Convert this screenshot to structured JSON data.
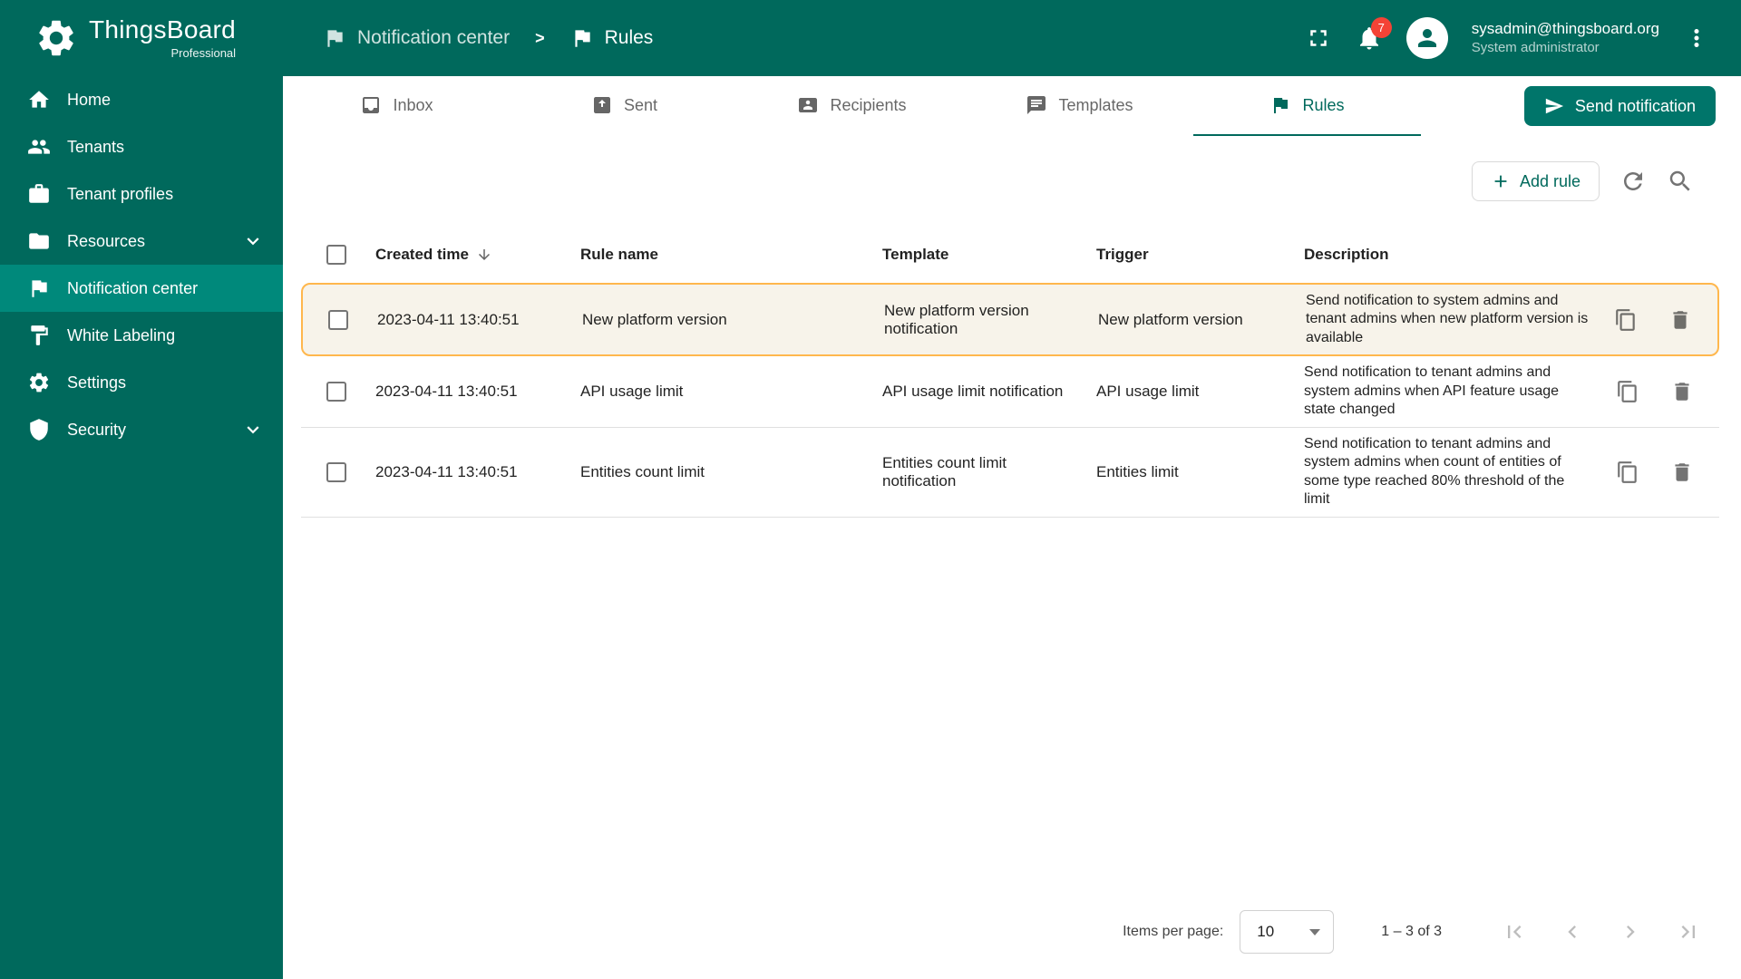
{
  "brand": {
    "name": "ThingsBoard",
    "subtitle": "Professional"
  },
  "header": {
    "breadcrumb": [
      {
        "label": "Notification center",
        "icon": "notification-center-icon"
      },
      {
        "label": "Rules",
        "icon": "rules-icon"
      }
    ],
    "notifications_badge": "7",
    "user": {
      "email": "sysadmin@thingsboard.org",
      "role": "System administrator"
    },
    "icons": [
      "fullscreen-icon",
      "bell-icon",
      "avatar-icon",
      "more-vert-icon"
    ]
  },
  "sidebar": {
    "items": [
      {
        "label": "Home",
        "icon": "home-icon"
      },
      {
        "label": "Tenants",
        "icon": "tenants-icon"
      },
      {
        "label": "Tenant profiles",
        "icon": "tenant-profiles-icon"
      },
      {
        "label": "Resources",
        "icon": "folder-icon",
        "expandable": true
      },
      {
        "label": "Notification center",
        "icon": "notification-center-icon",
        "active": true
      },
      {
        "label": "White Labeling",
        "icon": "paint-icon"
      },
      {
        "label": "Settings",
        "icon": "gear-icon"
      },
      {
        "label": "Security",
        "icon": "shield-icon",
        "expandable": true
      }
    ]
  },
  "tabs": [
    {
      "label": "Inbox",
      "icon": "inbox-icon"
    },
    {
      "label": "Sent",
      "icon": "sent-icon"
    },
    {
      "label": "Recipients",
      "icon": "recipients-icon"
    },
    {
      "label": "Templates",
      "icon": "templates-icon"
    },
    {
      "label": "Rules",
      "icon": "rules-icon",
      "active": true
    }
  ],
  "actions": {
    "send_notification": "Send notification",
    "add_rule": "Add rule"
  },
  "table": {
    "columns": [
      "Created time",
      "Rule name",
      "Template",
      "Trigger",
      "Description"
    ],
    "sort": {
      "column": "Created time",
      "direction": "desc"
    },
    "rows": [
      {
        "created_time": "2023-04-11 13:40:51",
        "rule_name": "New platform version",
        "template": "New platform version notification",
        "trigger": "New platform version",
        "description": "Send notification to system admins and tenant admins when new platform version is available",
        "highlighted": true
      },
      {
        "created_time": "2023-04-11 13:40:51",
        "rule_name": "API usage limit",
        "template": "API usage limit notification",
        "trigger": "API usage limit",
        "description": "Send notification to tenant admins and system admins when API feature usage state changed",
        "highlighted": false
      },
      {
        "created_time": "2023-04-11 13:40:51",
        "rule_name": "Entities count limit",
        "template": "Entities count limit notification",
        "trigger": "Entities limit",
        "description": "Send notification to tenant admins and system admins when count of entities of some type reached 80% threshold of the limit",
        "highlighted": false
      }
    ]
  },
  "pagination": {
    "items_per_page_label": "Items per page:",
    "items_per_page": "10",
    "range": "1 – 3 of 3"
  },
  "colors": {
    "primary": "#00695C",
    "active_sidebar_item": "#00897B",
    "button": "#00756A",
    "highlight_border": "#FFB74D",
    "highlight_background": "#F7F3EA",
    "badge": "#F44336"
  }
}
